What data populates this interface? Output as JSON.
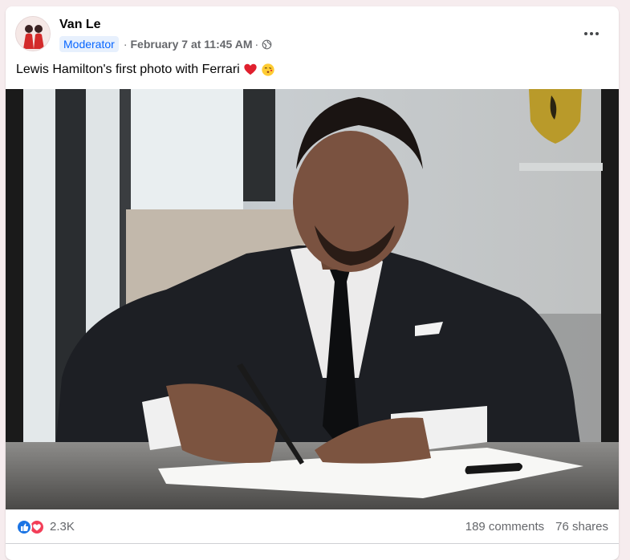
{
  "post": {
    "author": "Van Le",
    "badge": "Moderator",
    "separator": "·",
    "date": "February 7 at 11:45 AM",
    "date_separator": "·",
    "privacy_icon": "globe-icon",
    "more_icon": "more-horizontal-icon",
    "text": "Lewis Hamilton's first photo with Ferrari",
    "emojis": [
      "heart-emoji",
      "kiss-emoji"
    ]
  },
  "stats": {
    "reaction_icons": [
      "like-icon",
      "love-icon"
    ],
    "reaction_count": "2.3K",
    "comments": "189 comments",
    "shares": "76 shares"
  },
  "colors": {
    "accent": "#0866ff",
    "like": "#1b74e4",
    "love": "#f33e58",
    "muted_text": "#65676b",
    "page_bg": "#f6ecee"
  }
}
